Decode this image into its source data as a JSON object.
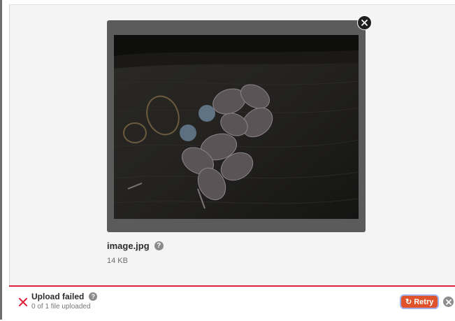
{
  "file": {
    "name": "image.jpg",
    "size": "14 KB",
    "help_glyph": "?",
    "remove_icon": "close-icon"
  },
  "status": {
    "title": "Upload failed",
    "help_glyph": "?",
    "subtitle": "0 of 1 file uploaded",
    "fail_icon": "x-icon"
  },
  "actions": {
    "retry_label": "Retry",
    "retry_icon": "refresh-icon",
    "cancel_icon": "close-icon"
  },
  "colors": {
    "error": "#e0203a",
    "retry": "#e0522a",
    "focus_ring": "#9fb1e8",
    "preview_frame": "#5b5b5b"
  }
}
